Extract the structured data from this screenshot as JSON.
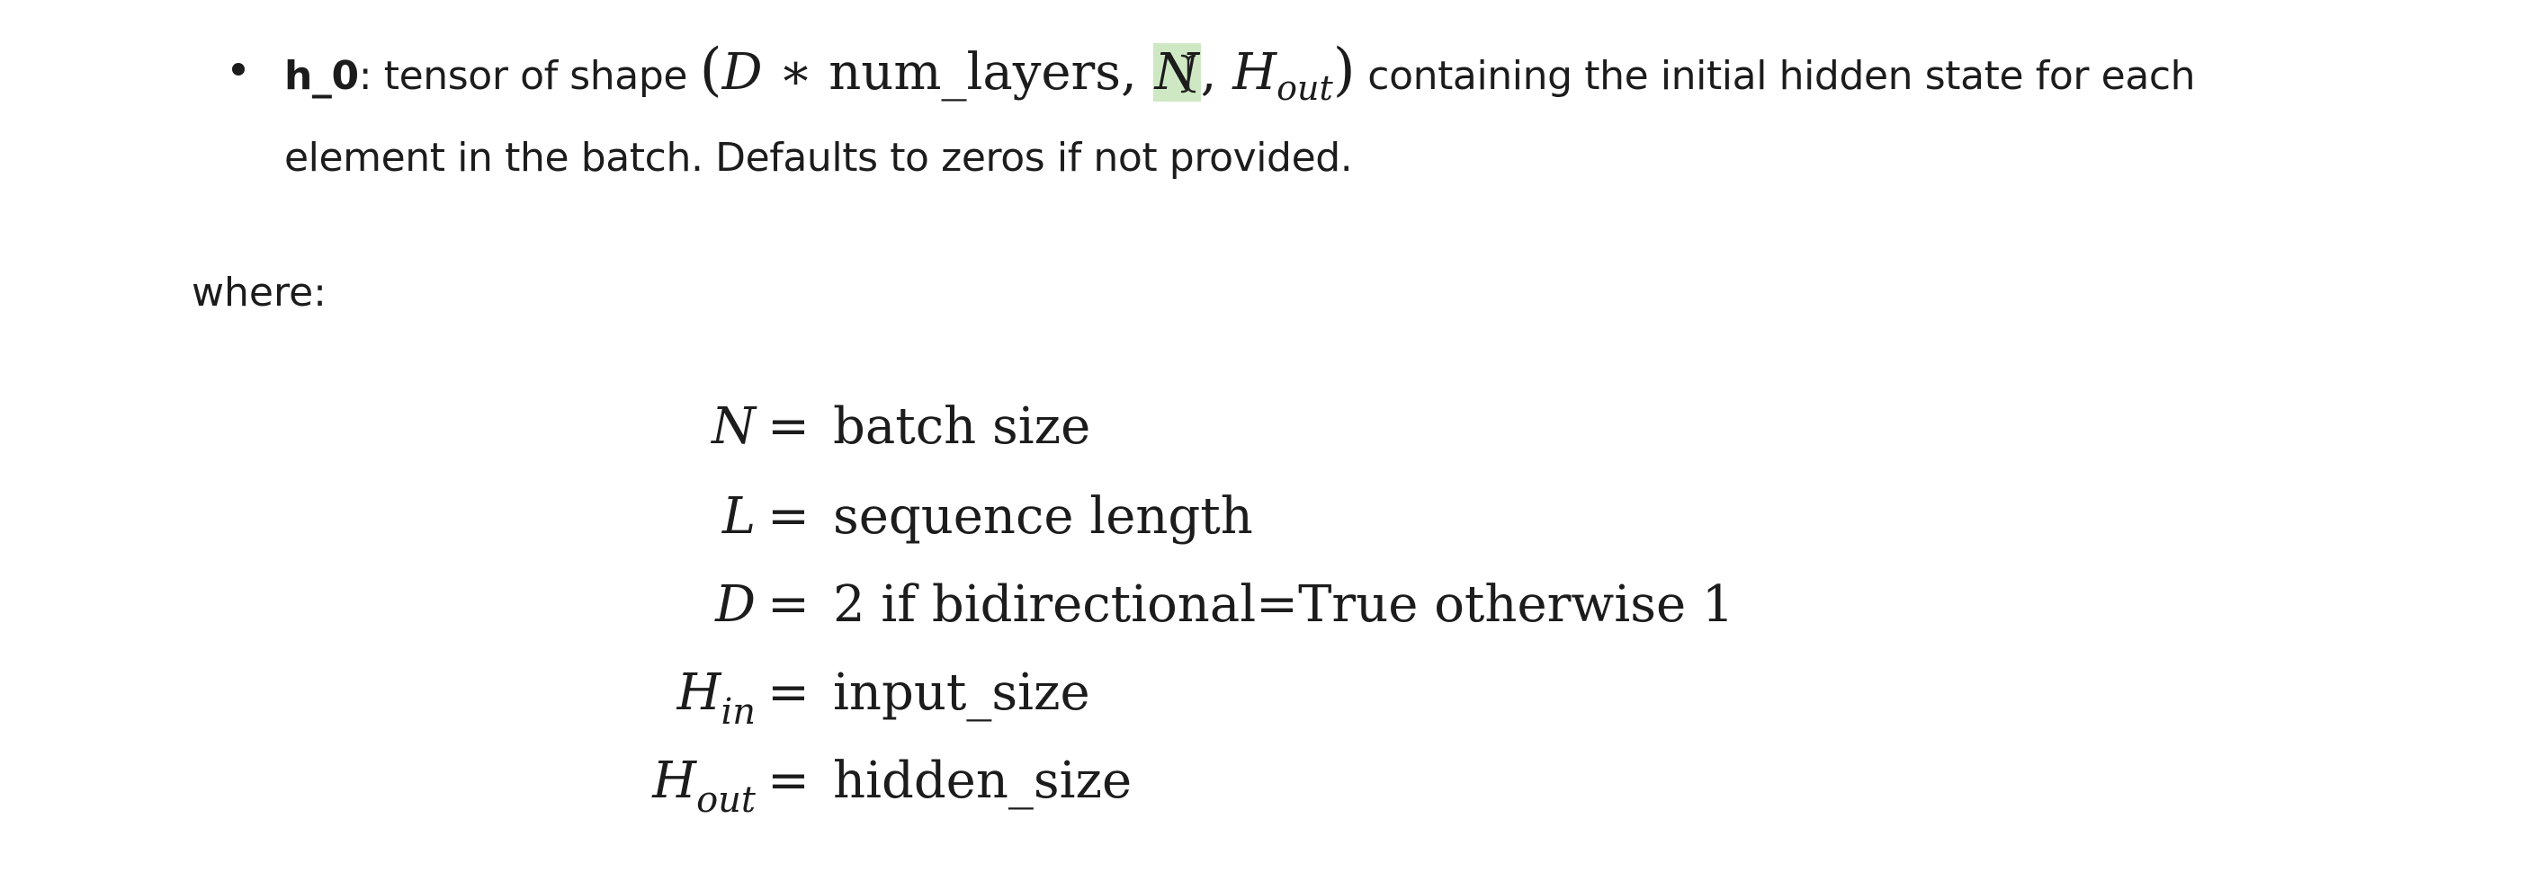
{
  "bullet": {
    "param": "h_0",
    "intro": ": tensor of shape ",
    "shape": {
      "open": "(",
      "part_d": "D",
      "op": " ∗ ",
      "part_layers": "num_layers",
      "comma1": ", ",
      "part_n": "N",
      "comma2": ", ",
      "part_h": "H",
      "part_h_sub": "out",
      "close": ")"
    },
    "rest_line1": " containing the initial hidden state for each",
    "line2": "element in the batch. Defaults to zeros if not provided."
  },
  "where_label": "where:",
  "definitions": [
    {
      "symbol": "N",
      "sub": "",
      "equals": "=",
      "value": "batch size"
    },
    {
      "symbol": "L",
      "sub": "",
      "equals": "=",
      "value": "sequence length"
    },
    {
      "symbol": "D",
      "sub": "",
      "equals": "=",
      "value": "2 if bidirectional=True otherwise 1"
    },
    {
      "symbol": "H",
      "sub": "in",
      "equals": "=",
      "value": "input_size"
    },
    {
      "symbol": "H",
      "sub": "out",
      "equals": "=",
      "value": "hidden_size"
    }
  ],
  "colors": {
    "text": "#1c1c1c",
    "highlight": "#cfe8c4",
    "background": "#ffffff"
  },
  "icons": {
    "bullet": "bullet-dot-icon",
    "cursor": "text-cursor-icon"
  }
}
